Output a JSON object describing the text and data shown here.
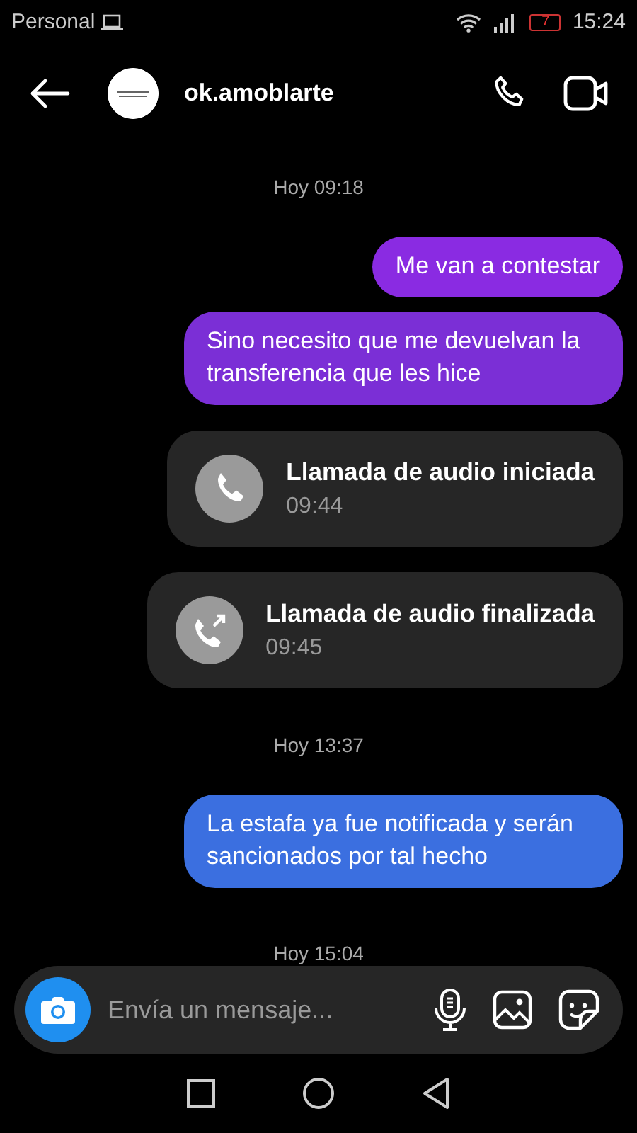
{
  "status_bar": {
    "carrier": "Personal",
    "battery": "7",
    "time": "15:24"
  },
  "header": {
    "username": "ok.amoblarte"
  },
  "messages": [
    {
      "kind": "date",
      "text": "Hoy 09:18"
    },
    {
      "kind": "sent",
      "text": "Me van a contestar",
      "color": "#8a2be2"
    },
    {
      "kind": "sent",
      "text": "Sino necesito que me devuelvan la transferencia que les hice",
      "color": "#7b2fd6"
    },
    {
      "kind": "call",
      "ended": false,
      "title": "Llamada de audio iniciada",
      "time": "09:44"
    },
    {
      "kind": "call",
      "ended": true,
      "title": "Llamada de audio finalizada",
      "time": "09:45"
    },
    {
      "kind": "date",
      "text": "Hoy 13:37"
    },
    {
      "kind": "sent",
      "text": "La estafa ya fue notificada y serán sancionados por tal hecho",
      "color": "#3b6fe0"
    },
    {
      "kind": "date",
      "text": "Hoy 15:04"
    }
  ],
  "composer": {
    "placeholder": "Envía un mensaje..."
  }
}
